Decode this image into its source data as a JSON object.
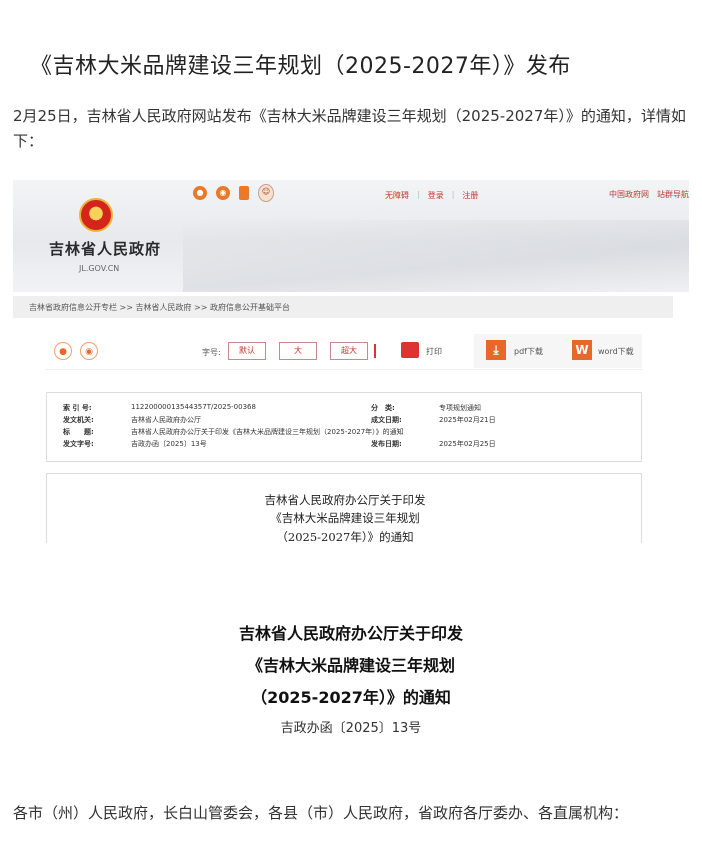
{
  "article": {
    "title": "《吉林大米品牌建设三年规划（2025-2027年）》发布",
    "intro": "2月25日，吉林省人民政府网站发布《吉林大米品牌建设三年规划（2025-2027年）》的通知，详情如下："
  },
  "screenshot": {
    "site_name": "吉林省人民政府",
    "site_domain": "JL.GOV.CN",
    "top_icons": [
      "wechat-icon",
      "weibo-icon",
      "mobile-icon",
      "mascot-icon"
    ],
    "top_links": [
      "无障碍",
      "登录",
      "注册"
    ],
    "top_right_links": [
      "中国政府网",
      "站群导航"
    ],
    "breadcrumb": "吉林省政府信息公开专栏 >> 吉林省人民政府 >> 政府信息公开基础平台",
    "toolbar": {
      "zoom_label": "字号:",
      "zoom_options": [
        "默认",
        "大",
        "超大"
      ],
      "print_label": "打印",
      "pdf_label": "pdf下载",
      "word_label": "word下载"
    },
    "meta": [
      {
        "k1": "索 引 号:",
        "v1": "11220000013544357T/2025-00368",
        "k2": "分　类:",
        "v2": "专项规划通知"
      },
      {
        "k1": "发文机关:",
        "v1": "吉林省人民政府办公厅",
        "k2": "成文日期:",
        "v2": "2025年02月21日"
      },
      {
        "k1": "标　　题:",
        "v1": "吉林省人民政府办公厅关于印发《吉林大米品牌建设三年规划（2025-2027年）》的通知",
        "k2": "",
        "v2": ""
      },
      {
        "k1": "发文字号:",
        "v1": "吉政办函〔2025〕13号",
        "k2": "发布日期:",
        "v2": "2025年02月25日"
      }
    ],
    "doc_heading": [
      "吉林省人民政府办公厅关于印发",
      "《吉林大米品牌建设三年规划",
      "（2025-2027年）》的通知"
    ]
  },
  "notice": {
    "heading": [
      "吉林省人民政府办公厅关于印发",
      "《吉林大米品牌建设三年规划",
      "（2025-2027年）》的通知"
    ],
    "doc_number": "吉政办函〔2025〕13号",
    "recipients": "各市（州）人民政府，长白山管委会，各县（市）人民政府，省政府各厅委办、各直属机构："
  }
}
